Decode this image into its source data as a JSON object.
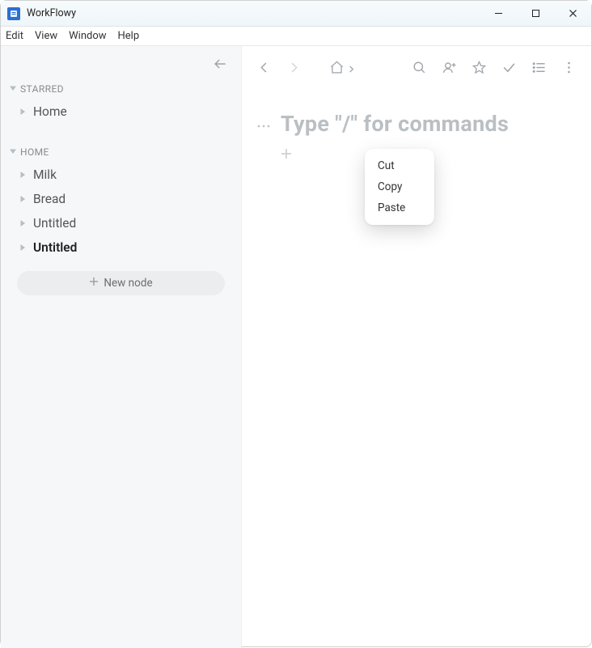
{
  "window": {
    "title": "WorkFlowy"
  },
  "menubar": [
    "Edit",
    "View",
    "Window",
    "Help"
  ],
  "sidebar": {
    "sections": [
      {
        "label": "STARRED",
        "items": [
          {
            "label": "Home",
            "active": false
          }
        ]
      },
      {
        "label": "HOME",
        "items": [
          {
            "label": "Milk",
            "active": false
          },
          {
            "label": "Bread",
            "active": false
          },
          {
            "label": "Untitled",
            "active": false
          },
          {
            "label": "Untitled",
            "active": true
          }
        ]
      }
    ],
    "new_node_label": "New node"
  },
  "editor": {
    "placeholder": "Type \"/\" for commands"
  },
  "context_menu": {
    "items": [
      "Cut",
      "Copy",
      "Paste"
    ]
  }
}
